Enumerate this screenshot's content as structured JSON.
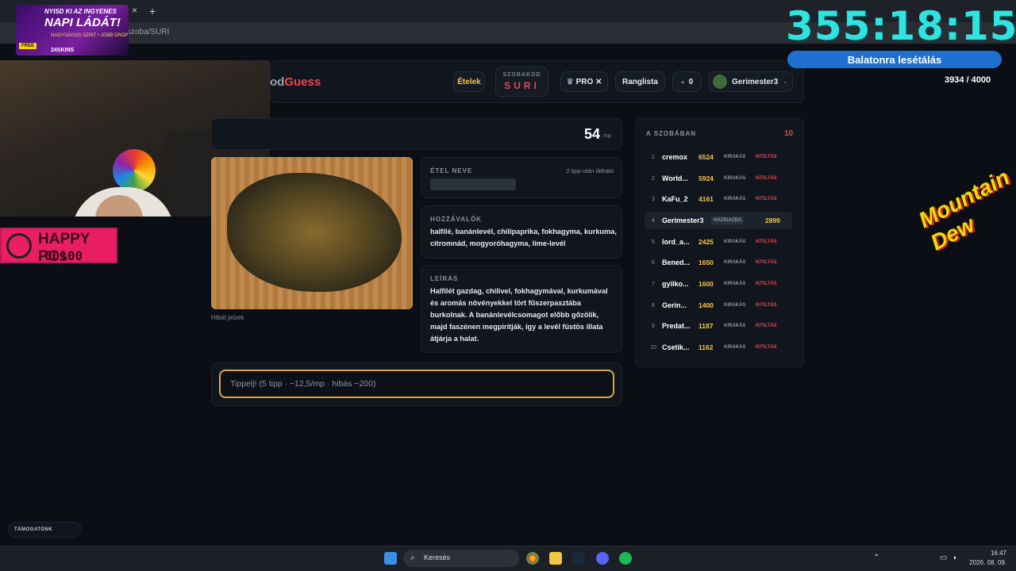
{
  "browser": {
    "url": "szoba/SURI",
    "new_tab": "+",
    "tab_close": "×"
  },
  "ad": {
    "line1": "NYISD KI AZ INGYENES",
    "line2": "NAPI LÁDÁT!",
    "line3": "NAGYSÁGOS SZINT • JOBB DROP",
    "free": "FREE",
    "brand": "24SKINS"
  },
  "app": {
    "logo_prefix": "od",
    "logo_accent": "Guess",
    "nav_foods": "Ételek",
    "room_code_label": "SZOBAKÓD",
    "room_code": "SURI",
    "pro_label": "PRO ✕",
    "ranking_label": "Ranglista",
    "coins": "0",
    "username": "Gerimester3",
    "timer_value": "54",
    "timer_unit": "mp",
    "report_label": "Hibát jelzek"
  },
  "cards": {
    "name_header": "ÉTEL NEVE",
    "name_hint": "2 tipp után látható",
    "ingredients_header": "HOZZÁVALÓK",
    "ingredients_line1": "halfilé, banánlevél, chilipaprika, fokhagyma, kurkuma,",
    "ingredients_line2": "citromnád, mogyoróhagyma, lime-levél",
    "description_header": "LEÍRÁS",
    "description_lines": [
      "Halfilét gazdag, chilivel, fokhagymával, kurkumával",
      "és aromás növényekkel tört fűszerpasztába",
      "burkolnak. A banánlevélcsomagot előbb gőzölik,",
      "majd faszénen megpirítják, így a levél füstös illata",
      "átjárja a halat."
    ]
  },
  "guess": {
    "placeholder": "Tippelj! (5 tipp · −12,5/mp · hibás −200)"
  },
  "room": {
    "title": "A SZOBÁBAN",
    "count": "10",
    "host_badge": "HÁZIGAZDA",
    "players": [
      {
        "rank": "1",
        "name": "cremox",
        "score": "6524",
        "kick": "KIRAKÁS",
        "ban": "KITILTÁS"
      },
      {
        "rank": "2",
        "name": "World...",
        "score": "5924",
        "kick": "KIRAKÁS",
        "ban": "KITILTÁS"
      },
      {
        "rank": "3",
        "name": "KaFu_2",
        "score": "4161",
        "kick": "KIRAKÁS",
        "ban": "KITILTÁS"
      },
      {
        "rank": "4",
        "name": "Gerimester3",
        "score": "2899",
        "kick": "",
        "ban": ""
      },
      {
        "rank": "5",
        "name": "lord_a...",
        "score": "2425",
        "kick": "KIRAKÁS",
        "ban": "KITILTÁS"
      },
      {
        "rank": "6",
        "name": "Bened...",
        "score": "1650",
        "kick": "KIRAKÁS",
        "ban": "KITILTÁS"
      },
      {
        "rank": "7",
        "name": "gyilko...",
        "score": "1600",
        "kick": "KIRAKÁS",
        "ban": "KITILTÁS"
      },
      {
        "rank": "8",
        "name": "Gerin...",
        "score": "1400",
        "kick": "KIRAKÁS",
        "ban": "KITILTÁS"
      },
      {
        "rank": "9",
        "name": "Predat...",
        "score": "1187",
        "kick": "KIRAKÁS",
        "ban": "KITILTÁS"
      },
      {
        "rank": "10",
        "name": "Csetik...",
        "score": "1162",
        "kick": "KIRAKÁS",
        "ban": "KITILTÁS"
      }
    ]
  },
  "overlay": {
    "big_timer": "355:18:15",
    "goal_label": "Balatonra lesétálás",
    "goal_progress": "3934 / 4000",
    "happy_line1": "HAPPY PCs",
    "happy_line2": "00100",
    "dew": "Mountain Dew",
    "support_label": "TÁMOGATÓNK"
  },
  "taskbar": {
    "search_label": "Keresés",
    "time": "16:47",
    "date": "2026. 08. 09."
  },
  "colors": {
    "accent_red": "#e5484d",
    "accent_gold": "#f5c451",
    "timer_cyan": "#2fe3e0",
    "goal_blue": "#1f6fd1"
  }
}
